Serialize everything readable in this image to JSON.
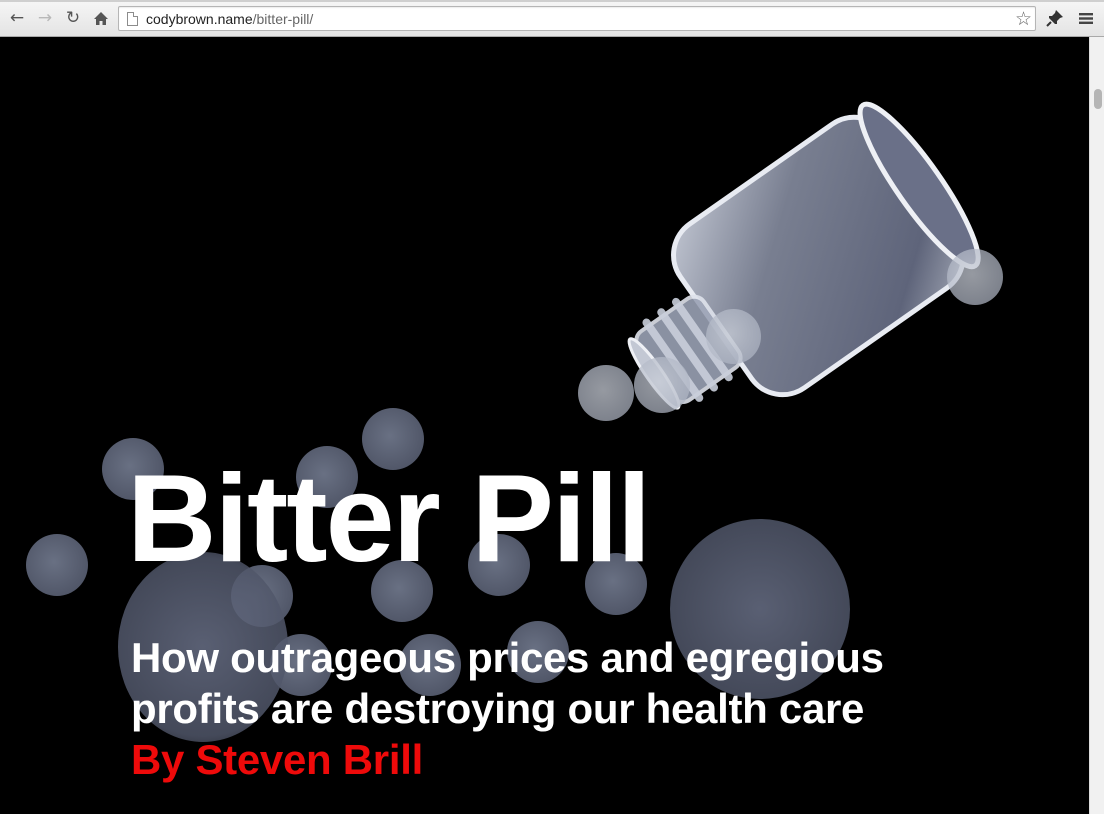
{
  "browser": {
    "url_host": "codybrown.name",
    "url_path": "/bitter-pill/",
    "icons": {
      "back": "back-arrow-icon",
      "forward": "forward-arrow-icon",
      "reload": "reload-icon",
      "home": "home-icon",
      "page": "page-icon",
      "bookmark": "star-icon",
      "extension": "pin-icon",
      "menu": "menu-icon"
    }
  },
  "article": {
    "title": "Bitter Pill",
    "dek": "How outrageous prices and egregious profits are destroying our health care",
    "byline": "By Steven Brill"
  },
  "colors": {
    "background": "#000000",
    "title": "#ffffff",
    "byline": "#ee0a0a"
  }
}
